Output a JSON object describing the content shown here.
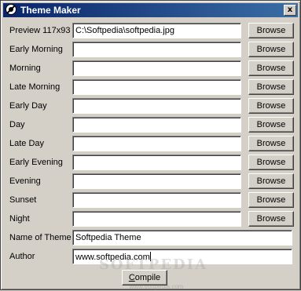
{
  "window": {
    "title": "Theme Maker",
    "close_glyph": "x",
    "icon": "theme-maker-icon"
  },
  "preview": {
    "label": "Preview 117x93",
    "value": "C:\\Softpedia\\softpedia.jpg",
    "button": "Browse"
  },
  "times": [
    {
      "label": "Early Morning",
      "value": "",
      "button": "Browse"
    },
    {
      "label": "Morning",
      "value": "",
      "button": "Browse"
    },
    {
      "label": "Late Morning",
      "value": "",
      "button": "Browse"
    },
    {
      "label": "Early Day",
      "value": "",
      "button": "Browse"
    },
    {
      "label": "Day",
      "value": "",
      "button": "Browse"
    },
    {
      "label": "Late Day",
      "value": "",
      "button": "Browse"
    },
    {
      "label": "Early Evening",
      "value": "",
      "button": "Browse"
    },
    {
      "label": "Evening",
      "value": "",
      "button": "Browse"
    },
    {
      "label": "Sunset",
      "value": "",
      "button": "Browse"
    },
    {
      "label": "Night",
      "value": "",
      "button": "Browse"
    }
  ],
  "theme_name": {
    "label": "Name of Theme",
    "value": "Softpedia Theme"
  },
  "author": {
    "label": "Author",
    "value": "www.softpedia.com"
  },
  "compile": {
    "label_first": "C",
    "label_rest": "ompile"
  },
  "watermark": {
    "main": "SOFTPEDIA",
    "sub": "www.softpedia.com"
  }
}
